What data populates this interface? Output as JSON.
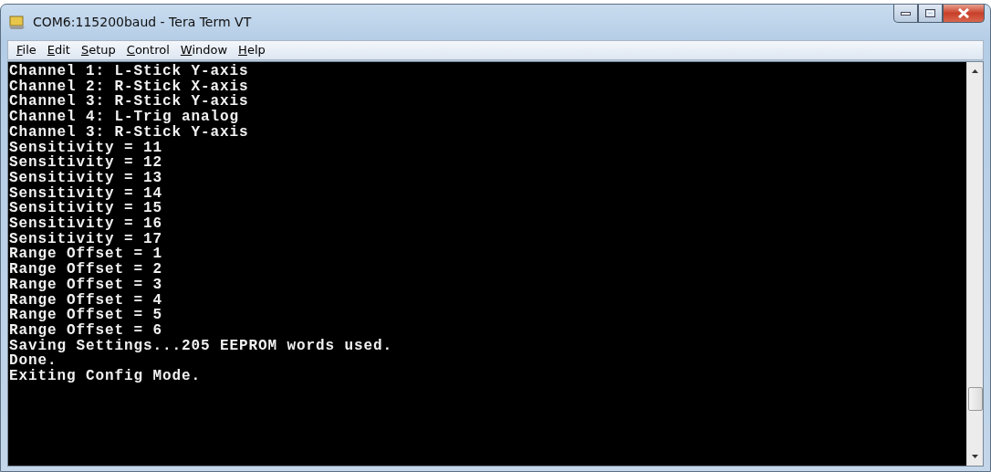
{
  "window": {
    "title": "COM6:115200baud - Tera Term VT"
  },
  "menu": [
    "File",
    "Edit",
    "Setup",
    "Control",
    "Window",
    "Help"
  ],
  "terminal": {
    "lines": [
      "Channel 1: L-Stick Y-axis",
      "Channel 2: R-Stick X-axis",
      "Channel 3: R-Stick Y-axis",
      "Channel 4: L-Trig analog",
      "Channel 3: R-Stick Y-axis",
      "Sensitivity = 11",
      "Sensitivity = 12",
      "Sensitivity = 13",
      "Sensitivity = 14",
      "Sensitivity = 15",
      "Sensitivity = 16",
      "Sensitivity = 17",
      "Range Offset = 1",
      "Range Offset = 2",
      "Range Offset = 3",
      "Range Offset = 4",
      "Range Offset = 5",
      "Range Offset = 6",
      "Saving Settings...205 EEPROM words used.",
      "Done.",
      "Exiting Config Mode."
    ]
  }
}
